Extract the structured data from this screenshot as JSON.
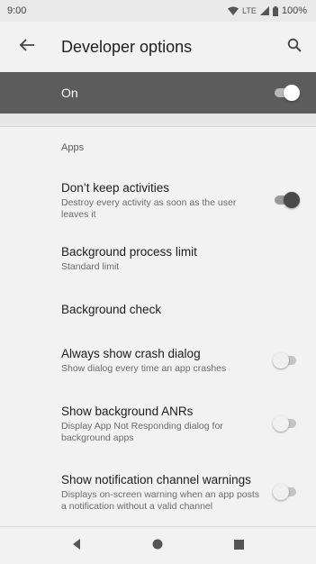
{
  "status_bar": {
    "time": "9:00",
    "network": "LTE",
    "battery": "100%"
  },
  "app_bar": {
    "title": "Developer options",
    "back_icon": "arrow-back-icon",
    "search_icon": "search-icon"
  },
  "master_switch": {
    "label": "On",
    "state": "on"
  },
  "apps_section": {
    "header": "Apps",
    "items": [
      {
        "title": "Don’t keep activities",
        "summary": "Destroy every activity as soon as the user leaves it",
        "toggle": "on"
      },
      {
        "title": "Background process limit",
        "summary": "Standard limit"
      },
      {
        "title": "Background check"
      },
      {
        "title": "Always show crash dialog",
        "summary": "Show dialog every time an app crashes",
        "toggle": "off"
      },
      {
        "title": "Show background ANRs",
        "summary": "Display App Not Responding dialog for background apps",
        "toggle": "off"
      },
      {
        "title": "Show notification channel warnings",
        "summary": "Displays on-screen warning when an app posts a notification without a valid channel",
        "toggle": "off"
      }
    ]
  },
  "nav_bar": {
    "back_icon": "nav-back-icon",
    "home_icon": "nav-home-icon",
    "recents_icon": "nav-recents-icon"
  },
  "colors": {
    "header_bg": "#5c5c5c",
    "page_bg": "#f2f2f2",
    "switch_on_thumb": "#4a4a4a",
    "switch_off_thumb": "#f0f0f0"
  }
}
